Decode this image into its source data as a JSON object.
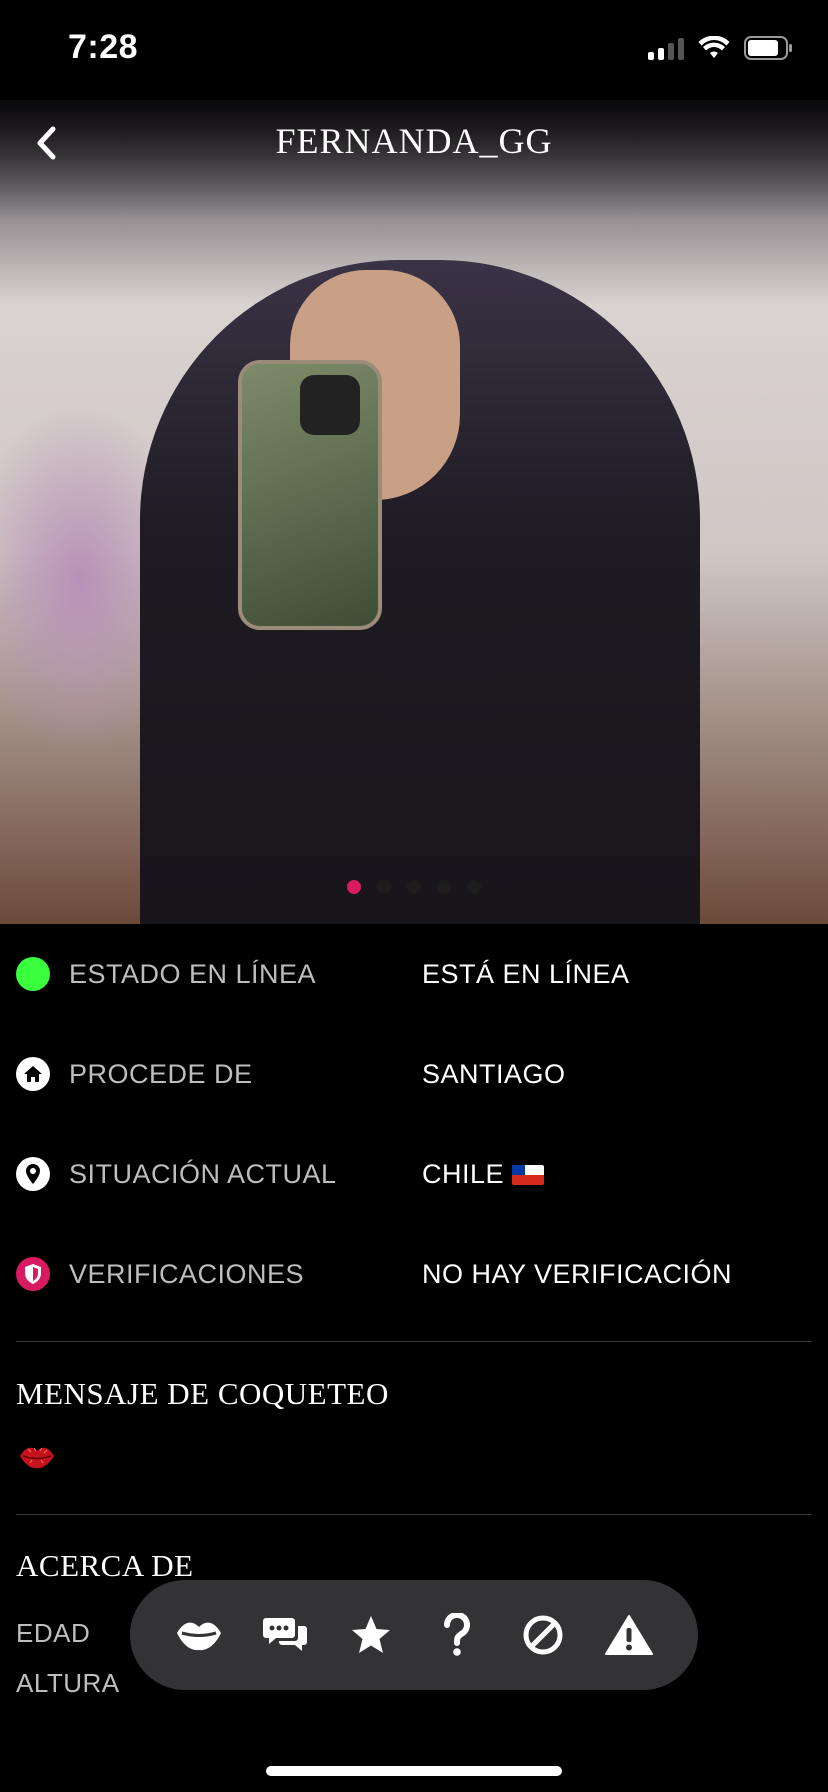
{
  "status_bar": {
    "time": "7:28",
    "icons": [
      "signal-icon",
      "wifi-icon",
      "battery-icon"
    ]
  },
  "header": {
    "title": "FERNANDA_GG",
    "back_icon": "chevron-left-icon"
  },
  "gallery": {
    "photo_count": 5,
    "active_index": 0,
    "active_color": "#d81b60"
  },
  "info": [
    {
      "icon": "online-dot-icon",
      "label": "ESTADO EN LÍNEA",
      "value": "ESTÁ EN LÍNEA"
    },
    {
      "icon": "home-icon",
      "label": "PROCEDE DE",
      "value": "SANTIAGO"
    },
    {
      "icon": "location-pin-icon",
      "label": "SITUACIÓN ACTUAL",
      "value": "CHILE"
    },
    {
      "icon": "shield-icon",
      "label": "VERIFICACIONES",
      "value": "NO HAY VERIFICACIÓN"
    }
  ],
  "flirt": {
    "title": "MENSAJE DE COQUETEO",
    "icon": "kiss-lips-icon"
  },
  "about": {
    "title": "ACERCA DE",
    "rows": [
      {
        "label": "EDAD",
        "value": ""
      },
      {
        "label": "ALTURA",
        "value": ""
      }
    ]
  },
  "actions": [
    "lips-icon",
    "chat-icon",
    "star-icon",
    "question-icon",
    "block-icon",
    "warning-icon"
  ],
  "colors": {
    "online": "#39ff3e",
    "shield": "#d81b60",
    "background": "#000000",
    "action_bar": "#333336"
  }
}
